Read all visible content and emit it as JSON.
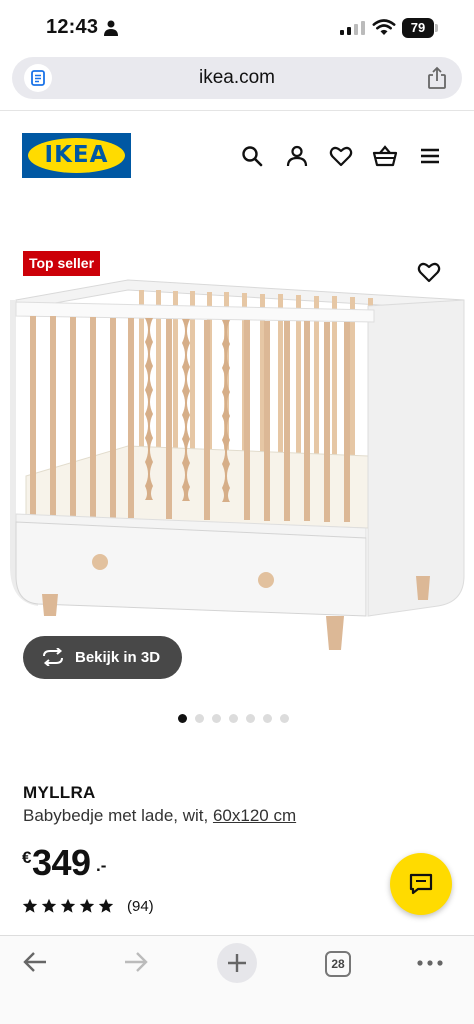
{
  "status_bar": {
    "time": "12:43",
    "battery": "79"
  },
  "browser": {
    "url": "ikea.com",
    "tab_count": "28"
  },
  "header": {
    "logo_text": "IKEA",
    "icons": [
      "search-icon",
      "user-icon",
      "heart-icon",
      "basket-icon",
      "menu-icon"
    ]
  },
  "product": {
    "badge": "Top seller",
    "view_3d_label": "Bekijk in 3D",
    "image_count": 7,
    "active_image": 1,
    "name": "MYLLRA",
    "description": "Babybedje met lade, wit, ",
    "size": "60x120 cm",
    "currency": "€",
    "price": "349",
    "price_suffix": ".-",
    "rating": 5,
    "review_count": "(94)"
  },
  "colors": {
    "ikea_blue": "#0058a3",
    "ikea_yellow": "#ffdb00",
    "badge_red": "#cc0008"
  }
}
